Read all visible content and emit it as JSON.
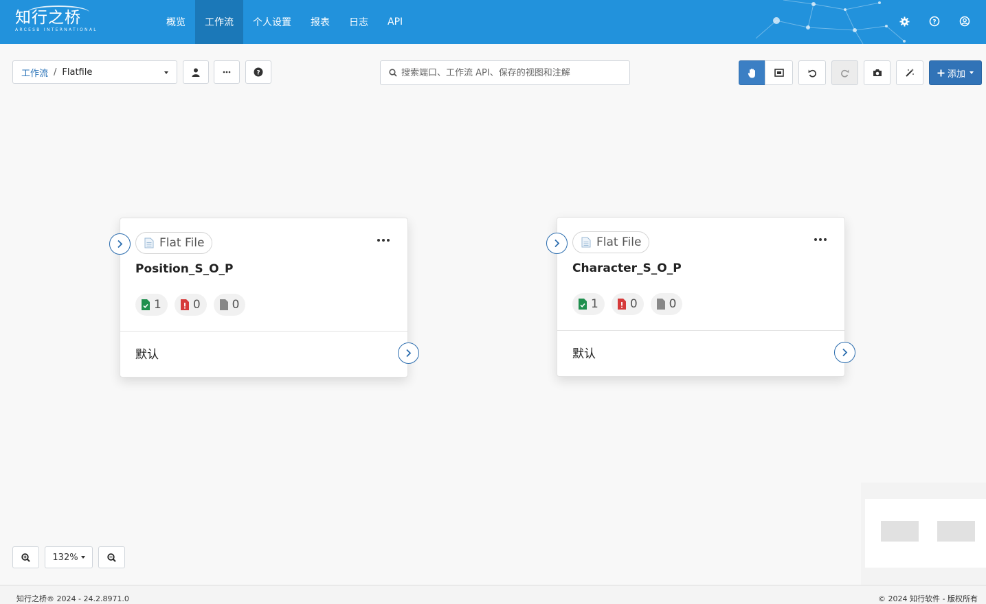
{
  "brand": {
    "name": "知行之桥",
    "tagline": "ARCESB INTERNATIONAL"
  },
  "nav": [
    {
      "label": "概览",
      "active": false
    },
    {
      "label": "工作流",
      "active": true
    },
    {
      "label": "个人设置",
      "active": false
    },
    {
      "label": "报表",
      "active": false
    },
    {
      "label": "日志",
      "active": false
    },
    {
      "label": "API",
      "active": false
    }
  ],
  "header_icons": [
    "gear-icon",
    "help-icon",
    "user-circle-icon"
  ],
  "breadcrumb": {
    "root": "工作流",
    "separator": "/",
    "current": "Flatfile"
  },
  "search": {
    "placeholder": "搜索端口、工作流 API、保存的视图和注解",
    "value": ""
  },
  "toolbar": {
    "add_label": "添加"
  },
  "cards": [
    {
      "type": "Flat File",
      "title": "Position_S_O_P",
      "stats": {
        "success": "1",
        "error": "0",
        "pending": "0"
      },
      "footer": "默认"
    },
    {
      "type": "Flat File",
      "title": "Character_S_O_P",
      "stats": {
        "success": "1",
        "error": "0",
        "pending": "0"
      },
      "footer": "默认"
    }
  ],
  "zoom": {
    "level": "132%"
  },
  "footer": {
    "left": "知行之桥® 2024 - 24.2.8971.0",
    "right": "© 2024 知行软件 - 版权所有"
  },
  "colors": {
    "header": "#2292dc",
    "nav_active": "#1b78b8",
    "primary": "#3173b7",
    "success": "#1f8f4e",
    "error": "#d63a3a"
  }
}
